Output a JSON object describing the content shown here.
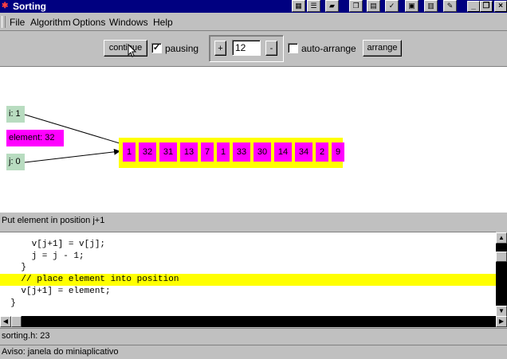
{
  "window": {
    "title": "Sorting"
  },
  "tray_icons": [
    "window-icon",
    "list-icon",
    "folder-icon",
    "copy-icon",
    "table-icon",
    "checklist-icon",
    "card-icon",
    "document-icon",
    "note-icon"
  ],
  "menu": [
    "File",
    "Algorithm",
    "Options",
    "Windows",
    "Help"
  ],
  "toolbar": {
    "continue_label": "continue",
    "pausing_label": "pausing",
    "pausing_checked": true,
    "plus_label": "+",
    "count_value": "12",
    "minus_label": "-",
    "auto_arrange_label": "auto-arrange",
    "auto_arrange_checked": false,
    "arrange_label": "arrange"
  },
  "variables": {
    "i": "i: 1",
    "element": "element: 32",
    "j": "j: 0"
  },
  "array": [
    "1",
    "32",
    "31",
    "13",
    "7",
    "1",
    "33",
    "30",
    "14",
    "34",
    "2",
    "9"
  ],
  "status": "Put element in position j+1",
  "code_lines": [
    {
      "text": "      v[j+1] = v[j];",
      "highlight": false
    },
    {
      "text": "      j = j - 1;",
      "highlight": false
    },
    {
      "text": "    }",
      "highlight": false
    },
    {
      "text": "    // place element into position",
      "highlight": true
    },
    {
      "text": "    v[j+1] = element;",
      "highlight": false
    },
    {
      "text": "  }",
      "highlight": false
    }
  ],
  "file_position": "sorting.h: 23",
  "applet_status": "Aviso: janela do miniaplicativo",
  "colors": {
    "title_bar": "#000080",
    "array_cell": "#ff00ff",
    "array_border": "#ffff00",
    "variable_box": "#b8dcc0",
    "highlight": "#ffff00"
  }
}
